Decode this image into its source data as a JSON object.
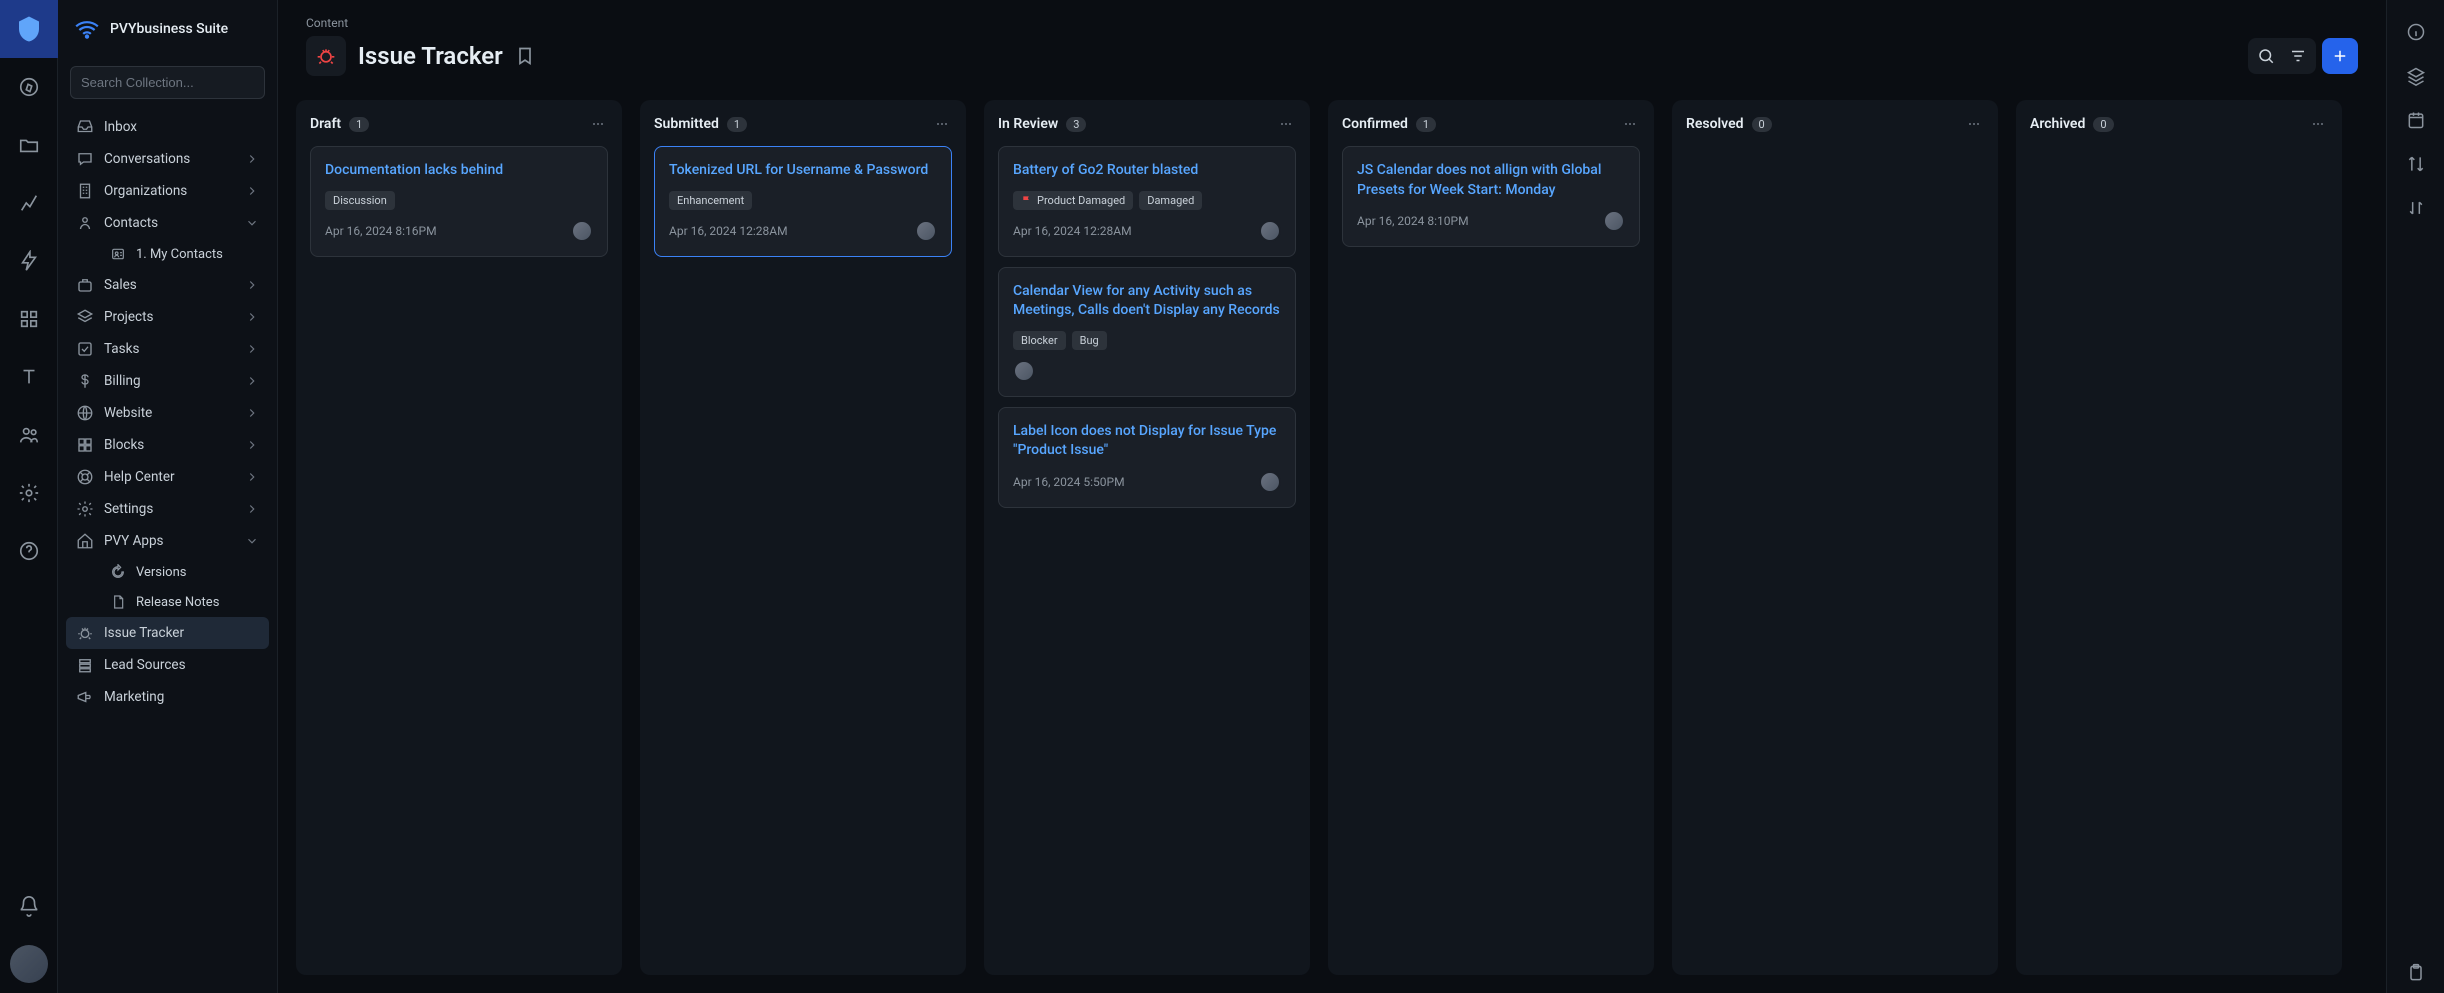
{
  "app_name": "PVYbusiness Suite",
  "breadcrumb": "Content",
  "page_title": "Issue Tracker",
  "search_placeholder": "Search Collection...",
  "sidebar": {
    "items": [
      {
        "label": "Inbox",
        "icon": "inbox",
        "chevron": false
      },
      {
        "label": "Conversations",
        "icon": "chat",
        "chevron": true
      },
      {
        "label": "Organizations",
        "icon": "building",
        "chevron": true
      },
      {
        "label": "Contacts",
        "icon": "user",
        "chevron": true,
        "expanded": true,
        "children": [
          {
            "label": "1. My Contacts",
            "icon": "person-card"
          }
        ]
      },
      {
        "label": "Sales",
        "icon": "briefcase",
        "chevron": true
      },
      {
        "label": "Projects",
        "icon": "layers",
        "chevron": true
      },
      {
        "label": "Tasks",
        "icon": "check-square",
        "chevron": true
      },
      {
        "label": "Billing",
        "icon": "dollar",
        "chevron": true
      },
      {
        "label": "Website",
        "icon": "globe",
        "chevron": true
      },
      {
        "label": "Blocks",
        "icon": "grid",
        "chevron": true
      },
      {
        "label": "Help Center",
        "icon": "life-ring",
        "chevron": true
      },
      {
        "label": "Settings",
        "icon": "gear",
        "chevron": true
      },
      {
        "label": "PVY Apps",
        "icon": "home",
        "chevron": true,
        "expanded": true,
        "children": [
          {
            "label": "Versions",
            "icon": "rotate"
          },
          {
            "label": "Release Notes",
            "icon": "file"
          }
        ]
      },
      {
        "label": "Issue Tracker",
        "icon": "bug",
        "active": true
      },
      {
        "label": "Lead Sources",
        "icon": "stack"
      },
      {
        "label": "Marketing",
        "icon": "megaphone"
      }
    ]
  },
  "columns": [
    {
      "id": "draft",
      "title": "Draft",
      "count": "1",
      "cards": [
        {
          "title": "Documentation lacks behind",
          "tags": [
            {
              "label": "Discussion"
            }
          ],
          "date": "Apr 16, 2024 8:16PM",
          "avatars": 1
        }
      ]
    },
    {
      "id": "submitted",
      "title": "Submitted",
      "count": "1",
      "selected": true,
      "cards": [
        {
          "title": "Tokenized URL for Username & Password",
          "tags": [
            {
              "label": "Enhancement"
            }
          ],
          "date": "Apr 16, 2024 12:28AM",
          "avatars": 1,
          "selected": true
        }
      ]
    },
    {
      "id": "in-review",
      "title": "In Review",
      "count": "3",
      "cards": [
        {
          "title": "Battery of Go2 Router blasted",
          "tags": [
            {
              "label": "Product Damaged",
              "flag": true
            },
            {
              "label": "Damaged"
            }
          ],
          "date": "Apr 16, 2024 12:28AM",
          "avatars": 1
        },
        {
          "title": "Calendar View for any Activity such as Meetings, Calls doen't Display any Records",
          "tags": [
            {
              "label": "Blocker"
            },
            {
              "label": "Bug"
            }
          ],
          "date": "",
          "avatars": 1
        },
        {
          "title": "Label Icon does not Display for Issue Type \"Product Issue\"",
          "tags": [],
          "date": "Apr 16, 2024 5:50PM",
          "avatars": 1
        }
      ]
    },
    {
      "id": "confirmed",
      "title": "Confirmed",
      "count": "1",
      "cards": [
        {
          "title": "JS Calendar does not allign with Global Presets for Week Start: Monday",
          "tags": [],
          "date": "Apr 16, 2024 8:10PM",
          "avatars": 1
        }
      ]
    },
    {
      "id": "resolved",
      "title": "Resolved",
      "count": "0",
      "cards": []
    },
    {
      "id": "archived",
      "title": "Archived",
      "count": "0",
      "cards": []
    }
  ]
}
